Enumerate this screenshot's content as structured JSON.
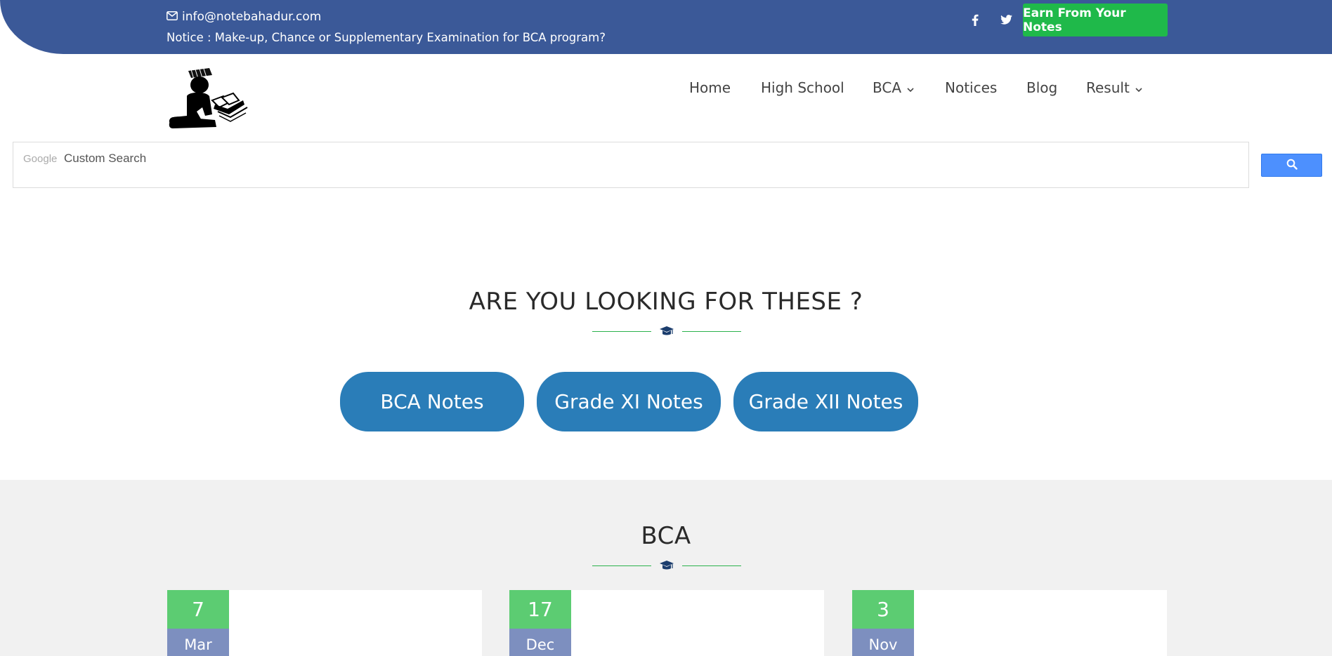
{
  "topbar": {
    "email": "info@notebahadur.com",
    "notice": "Notice : Make-up, Chance or Supplementary Examination for BCA program?",
    "earn_label": "Earn From Your Notes",
    "colors": {
      "bar": "#3b5998",
      "earn_button": "#1fb94a"
    }
  },
  "nav": {
    "items": [
      {
        "label": "Home"
      },
      {
        "label": "High School"
      },
      {
        "label": "BCA"
      },
      {
        "label": "Notices"
      },
      {
        "label": "Blog"
      },
      {
        "label": "Result"
      }
    ]
  },
  "search": {
    "brand": "Google",
    "placeholder": "Custom Search"
  },
  "looking": {
    "title": "ARE YOU LOOKING FOR THESE ?",
    "buttons": [
      {
        "label": "BCA Notes"
      },
      {
        "label": "Grade XI Notes"
      },
      {
        "label": "Grade XII Notes"
      }
    ]
  },
  "bca": {
    "title": "BCA",
    "cards": [
      {
        "day": "7",
        "month": "Mar"
      },
      {
        "day": "17",
        "month": "Dec"
      },
      {
        "day": "3",
        "month": "Nov"
      }
    ]
  }
}
